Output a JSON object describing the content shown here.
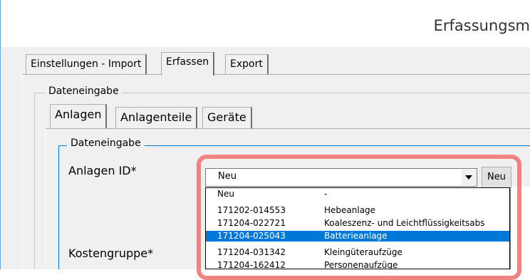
{
  "window": {
    "title": "Erfassungsm"
  },
  "outer_tabs": [
    {
      "label": "Einstellungen - Import"
    },
    {
      "label": "Erfassen"
    },
    {
      "label": "Export"
    }
  ],
  "outer_group": {
    "label": "Dateneingabe"
  },
  "inner_tabs": [
    {
      "label": "Anlagen"
    },
    {
      "label": "Anlagenteile"
    },
    {
      "label": "Geräte"
    }
  ],
  "inner_group": {
    "label": "Dateneingabe"
  },
  "fields": {
    "anlagen_id_label": "Anlagen ID*",
    "kostengruppe_label": "Kostengruppe*"
  },
  "combo": {
    "value": "Neu",
    "new_button": "Neu"
  },
  "dropdown": {
    "rows": [
      {
        "id": "Neu",
        "name": "-"
      },
      {
        "id": "171202-014553",
        "name": "Hebeanlage"
      },
      {
        "id": "171204-022721",
        "name": "Koaleszenz- und Leichtflüssigkeitsabs"
      },
      {
        "id": "171204-025043",
        "name": "Batterieanlage"
      },
      {
        "id": "171204-031342",
        "name": "Kleingüteraufzüge"
      },
      {
        "id": "171204-162412",
        "name": "Personenaufzüge"
      }
    ],
    "selected_index": 3
  },
  "colors": {
    "accent": "#0078d7",
    "highlight": "#ef7672"
  }
}
